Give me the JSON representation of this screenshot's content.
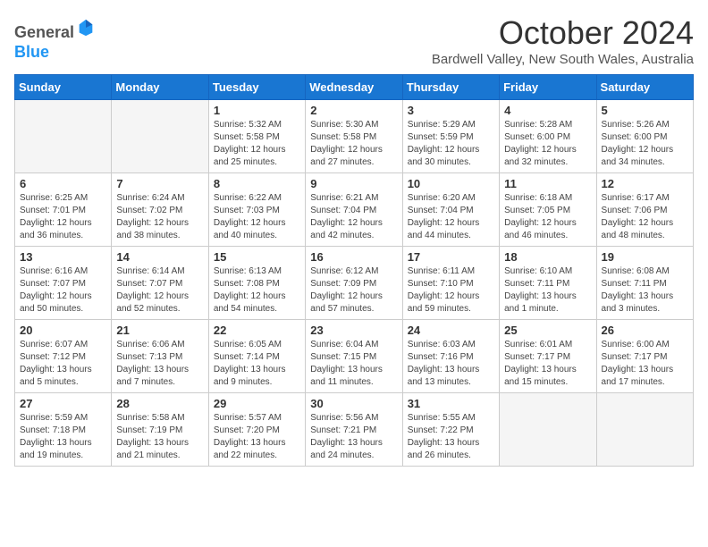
{
  "header": {
    "logo_general": "General",
    "logo_blue": "Blue",
    "title": "October 2024",
    "subtitle": "Bardwell Valley, New South Wales, Australia"
  },
  "days_of_week": [
    "Sunday",
    "Monday",
    "Tuesday",
    "Wednesday",
    "Thursday",
    "Friday",
    "Saturday"
  ],
  "weeks": [
    [
      {
        "day": "",
        "empty": true
      },
      {
        "day": "",
        "empty": true
      },
      {
        "day": "1",
        "sunrise": "5:32 AM",
        "sunset": "5:58 PM",
        "daylight": "12 hours and 25 minutes."
      },
      {
        "day": "2",
        "sunrise": "5:30 AM",
        "sunset": "5:58 PM",
        "daylight": "12 hours and 27 minutes."
      },
      {
        "day": "3",
        "sunrise": "5:29 AM",
        "sunset": "5:59 PM",
        "daylight": "12 hours and 30 minutes."
      },
      {
        "day": "4",
        "sunrise": "5:28 AM",
        "sunset": "6:00 PM",
        "daylight": "12 hours and 32 minutes."
      },
      {
        "day": "5",
        "sunrise": "5:26 AM",
        "sunset": "6:00 PM",
        "daylight": "12 hours and 34 minutes."
      }
    ],
    [
      {
        "day": "6",
        "sunrise": "6:25 AM",
        "sunset": "7:01 PM",
        "daylight": "12 hours and 36 minutes."
      },
      {
        "day": "7",
        "sunrise": "6:24 AM",
        "sunset": "7:02 PM",
        "daylight": "12 hours and 38 minutes."
      },
      {
        "day": "8",
        "sunrise": "6:22 AM",
        "sunset": "7:03 PM",
        "daylight": "12 hours and 40 minutes."
      },
      {
        "day": "9",
        "sunrise": "6:21 AM",
        "sunset": "7:04 PM",
        "daylight": "12 hours and 42 minutes."
      },
      {
        "day": "10",
        "sunrise": "6:20 AM",
        "sunset": "7:04 PM",
        "daylight": "12 hours and 44 minutes."
      },
      {
        "day": "11",
        "sunrise": "6:18 AM",
        "sunset": "7:05 PM",
        "daylight": "12 hours and 46 minutes."
      },
      {
        "day": "12",
        "sunrise": "6:17 AM",
        "sunset": "7:06 PM",
        "daylight": "12 hours and 48 minutes."
      }
    ],
    [
      {
        "day": "13",
        "sunrise": "6:16 AM",
        "sunset": "7:07 PM",
        "daylight": "12 hours and 50 minutes."
      },
      {
        "day": "14",
        "sunrise": "6:14 AM",
        "sunset": "7:07 PM",
        "daylight": "12 hours and 52 minutes."
      },
      {
        "day": "15",
        "sunrise": "6:13 AM",
        "sunset": "7:08 PM",
        "daylight": "12 hours and 54 minutes."
      },
      {
        "day": "16",
        "sunrise": "6:12 AM",
        "sunset": "7:09 PM",
        "daylight": "12 hours and 57 minutes."
      },
      {
        "day": "17",
        "sunrise": "6:11 AM",
        "sunset": "7:10 PM",
        "daylight": "12 hours and 59 minutes."
      },
      {
        "day": "18",
        "sunrise": "6:10 AM",
        "sunset": "7:11 PM",
        "daylight": "13 hours and 1 minute."
      },
      {
        "day": "19",
        "sunrise": "6:08 AM",
        "sunset": "7:11 PM",
        "daylight": "13 hours and 3 minutes."
      }
    ],
    [
      {
        "day": "20",
        "sunrise": "6:07 AM",
        "sunset": "7:12 PM",
        "daylight": "13 hours and 5 minutes."
      },
      {
        "day": "21",
        "sunrise": "6:06 AM",
        "sunset": "7:13 PM",
        "daylight": "13 hours and 7 minutes."
      },
      {
        "day": "22",
        "sunrise": "6:05 AM",
        "sunset": "7:14 PM",
        "daylight": "13 hours and 9 minutes."
      },
      {
        "day": "23",
        "sunrise": "6:04 AM",
        "sunset": "7:15 PM",
        "daylight": "13 hours and 11 minutes."
      },
      {
        "day": "24",
        "sunrise": "6:03 AM",
        "sunset": "7:16 PM",
        "daylight": "13 hours and 13 minutes."
      },
      {
        "day": "25",
        "sunrise": "6:01 AM",
        "sunset": "7:17 PM",
        "daylight": "13 hours and 15 minutes."
      },
      {
        "day": "26",
        "sunrise": "6:00 AM",
        "sunset": "7:17 PM",
        "daylight": "13 hours and 17 minutes."
      }
    ],
    [
      {
        "day": "27",
        "sunrise": "5:59 AM",
        "sunset": "7:18 PM",
        "daylight": "13 hours and 19 minutes."
      },
      {
        "day": "28",
        "sunrise": "5:58 AM",
        "sunset": "7:19 PM",
        "daylight": "13 hours and 21 minutes."
      },
      {
        "day": "29",
        "sunrise": "5:57 AM",
        "sunset": "7:20 PM",
        "daylight": "13 hours and 22 minutes."
      },
      {
        "day": "30",
        "sunrise": "5:56 AM",
        "sunset": "7:21 PM",
        "daylight": "13 hours and 24 minutes."
      },
      {
        "day": "31",
        "sunrise": "5:55 AM",
        "sunset": "7:22 PM",
        "daylight": "13 hours and 26 minutes."
      },
      {
        "day": "",
        "empty": true
      },
      {
        "day": "",
        "empty": true
      }
    ]
  ]
}
